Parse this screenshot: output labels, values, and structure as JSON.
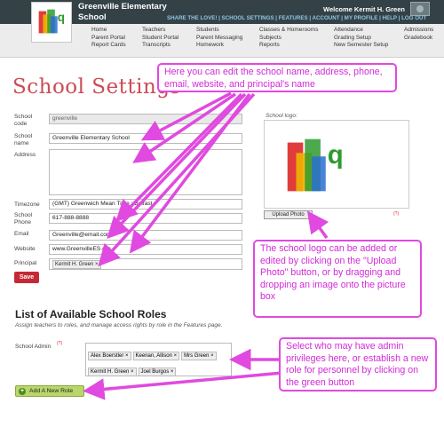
{
  "header": {
    "school_name": "Greenville Elementary School",
    "welcome": "Welcome Kermit H. Green",
    "top_links": "SHARE THE LOVE! | SCHOOL SETTINGS | FEATURES | ACCOUNT | MY PROFILE | HELP | LOG OUT"
  },
  "nav": {
    "col1": [
      "Home",
      "Parent Portal",
      "Report Cards"
    ],
    "col2": [
      "Teachers",
      "Student Portal",
      "Transcripts"
    ],
    "col3": [
      "Students",
      "Parent Messaging",
      "Homework"
    ],
    "col4": [
      "Classes & Homerooms",
      "Subjects",
      "Reports"
    ],
    "col5": [
      "Attendance",
      "Grading Setup",
      "New Semester Setup"
    ],
    "col6": [
      "Admissions",
      "Gradebook"
    ]
  },
  "page": {
    "title": "School Settings"
  },
  "form": {
    "code_label": "School code",
    "code_value": "greenville",
    "name_label": "School name",
    "name_value": "Greenville Elementary School",
    "address_label": "Address",
    "timezone_label": "Timezone",
    "timezone_value": "(GMT) Greenwich Mean Time : Belfast",
    "phone_label": "School Phone",
    "phone_value": "617-888-8888",
    "email_label": "Email",
    "email_value": "Greenville@email.com",
    "website_label": "Website",
    "website_value": "www.GreenvilleES.org",
    "principal_label": "Principal",
    "principal_value": "Kermit H. Green ×",
    "save": "Save"
  },
  "logo_section": {
    "label": "School logo:",
    "upload": "Upload Photo"
  },
  "roles": {
    "title": "List of Available School Roles",
    "description": "Assign teachers to roles, and manage access rights by role in the Features page.",
    "admin_label": "School Admin",
    "admins": [
      "Alex Boerstler ×",
      "Keenan, Allison ×",
      "Mrs Green ×",
      "Kermit H. Green ×",
      "Joel Burgos ×"
    ],
    "add_button": "Add A New Role"
  },
  "callouts": {
    "top": "Here you can edit the school name, address, phone, email, website, and principal's name",
    "logo": "The school logo can be added or edited by clicking on the \"Upload Photo\" button, or by dragging and dropping an image onto the picture box",
    "admin": "Select who may have admin privileges here, or establish a new role for personnel by clicking on the green button"
  },
  "colors": {
    "accent": "#cc4b56",
    "callout": "#e04ae0",
    "header": "#344248",
    "add_button": "#b8d66a"
  },
  "help_mark": "(?)"
}
